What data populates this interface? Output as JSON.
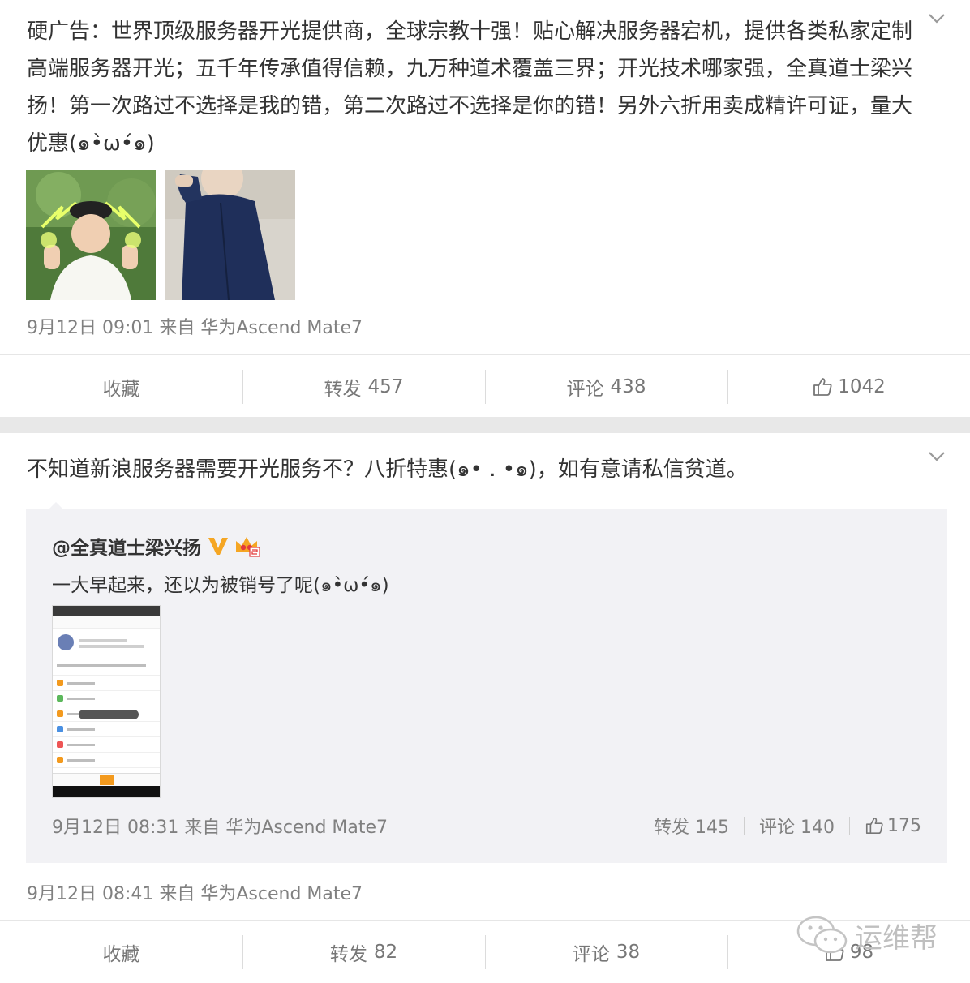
{
  "post1": {
    "text": "硬广告：世界顶级服务器开光提供商，全球宗教十强！贴心解决服务器宕机，提供各类私家定制高端服务器开光；五千年传承值得信赖，九万种道术覆盖三界；开光技术哪家强，全真道士梁兴扬！第一次路过不选择是我的错，第二次路过不选择是你的错！另外六折用卖成精许可证，量大优惠(๑•̀ω•́๑)",
    "meta": "9月12日 09:01 来自 华为Ascend Mate7",
    "actions": {
      "favorite": "收藏",
      "repost_label": "转发",
      "repost_count": "457",
      "comment_label": "评论",
      "comment_count": "438",
      "like_count": "1042"
    }
  },
  "post2": {
    "text": "不知道新浪服务器需要开光服务不？八折特惠(๑• . •๑)，如有意请私信贫道。",
    "repost": {
      "author": "@全真道士梁兴扬",
      "text": "一大早起来，还以为被销号了呢(๑•̀ω•́๑)",
      "meta": "9月12日 08:31 来自 华为Ascend Mate7",
      "repost_label": "转发",
      "repost_count": "145",
      "comment_label": "评论",
      "comment_count": "140",
      "like_count": "175"
    },
    "meta": "9月12日 08:41 来自 华为Ascend Mate7",
    "actions": {
      "favorite": "收藏",
      "repost_label": "转发",
      "repost_count": "82",
      "comment_label": "评论",
      "comment_count": "38",
      "like_count": "98"
    }
  },
  "watermark": {
    "text": "运维帮"
  },
  "icons": {
    "chevron": "chevron-down-icon",
    "like": "thumbs-up-icon",
    "verified": "verified-v-icon",
    "crown": "member-crown-icon",
    "wechat": "wechat-logo-icon"
  },
  "colors": {
    "accent_gold": "#f5a623",
    "text_primary": "#333333",
    "text_meta": "#808080",
    "repost_bg": "#f2f2f5"
  }
}
